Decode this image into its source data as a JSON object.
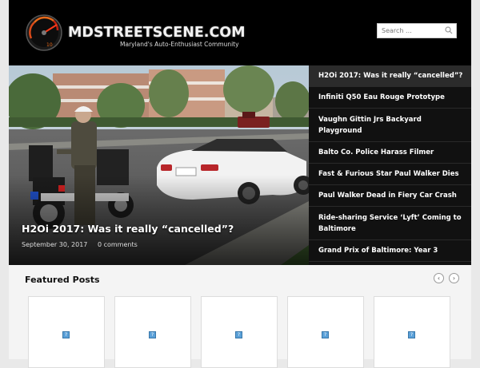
{
  "site": {
    "title": "MDSTREETSCENE.COM",
    "tagline": "Maryland's Auto-Enthusiast Community",
    "logo_gauge_number": "10"
  },
  "search": {
    "placeholder": "Search ..."
  },
  "hero": {
    "title": "H2Oi 2017: Was it really “cancelled”?",
    "date": "September 30, 2017",
    "comments": "0 comments"
  },
  "sidebar_posts": [
    "H2Oi 2017: Was it really “cancelled”?",
    "Infiniti Q50 Eau Rouge Prototype",
    "Vaughn Gittin Jrs Backyard Playground",
    "Balto Co. Police Harass Filmer",
    "Fast & Furious Star Paul Walker Dies",
    "Paul Walker Dead in Fiery Car Crash",
    "Ride-sharing Service ‘Lyft’ Coming to Baltimore",
    "Grand Prix of Baltimore: Year 3"
  ],
  "featured": {
    "title": "Featured Posts",
    "prev_icon": "‹",
    "next_icon": "›",
    "placeholder_icon": "?"
  }
}
